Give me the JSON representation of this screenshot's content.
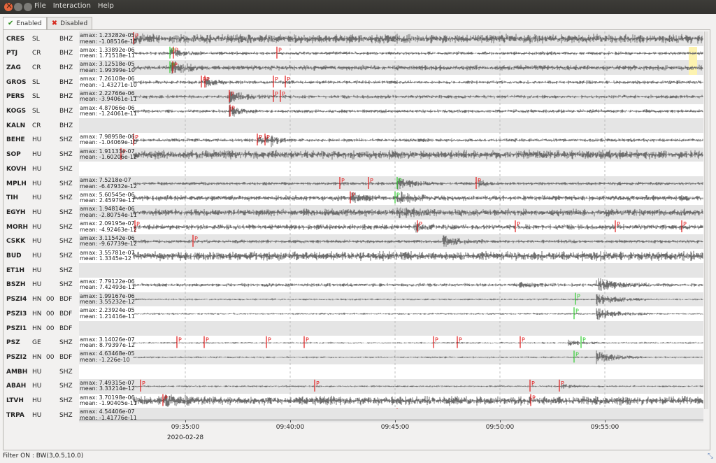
{
  "window": {
    "menu": [
      "File",
      "Interaction",
      "Help"
    ]
  },
  "tabs": [
    {
      "label": "Enabled",
      "icon": "check-icon",
      "active": true
    },
    {
      "label": "Disabled",
      "icon": "x-icon",
      "active": false
    }
  ],
  "colors": {
    "trace": "#6e6e6e",
    "pick_p": "#e01818",
    "pick_auto": "#2ecc2e",
    "highlight": "#fdf3b0",
    "band": "#e5e5e5"
  },
  "stations": [
    {
      "station": "CRES",
      "network": "SL",
      "location": "",
      "channel": "BHZ",
      "amax": "amax: 1.23282e-05",
      "mean": "mean: -1.08516e-10"
    },
    {
      "station": "PTJ",
      "network": "CR",
      "location": "",
      "channel": "BHZ",
      "amax": "amax: 1.33892e-06",
      "mean": "mean: 1.71518e-11"
    },
    {
      "station": "ZAG",
      "network": "CR",
      "location": "",
      "channel": "BHZ",
      "amax": "amax: 3.12518e-05",
      "mean": "mean: 1.99399e-10"
    },
    {
      "station": "GROS",
      "network": "SL",
      "location": "",
      "channel": "BHZ",
      "amax": "amax: 7.26108e-06",
      "mean": "mean: -1.43271e-10"
    },
    {
      "station": "PERS",
      "network": "SL",
      "location": "",
      "channel": "BHZ",
      "amax": "amax: 2.22766e-06",
      "mean": "mean: -3.94061e-11"
    },
    {
      "station": "KOGS",
      "network": "SL",
      "location": "",
      "channel": "BHZ",
      "amax": "amax: 4.87066e-06",
      "mean": "mean: -1.24061e-11"
    },
    {
      "station": "KALN",
      "network": "CR",
      "location": "",
      "channel": "BHZ",
      "amax": "",
      "mean": ""
    },
    {
      "station": "BEHE",
      "network": "HU",
      "location": "",
      "channel": "SHZ",
      "amax": "amax: 7.98958e-06",
      "mean": "mean: -1.04069e-10"
    },
    {
      "station": "SOP",
      "network": "HU",
      "location": "",
      "channel": "SHZ",
      "amax": "amax: 1.91133e-07",
      "mean": "mean: -1.60206e-12"
    },
    {
      "station": "KOVH",
      "network": "HU",
      "location": "",
      "channel": "SHZ",
      "amax": "",
      "mean": ""
    },
    {
      "station": "MPLH",
      "network": "HU",
      "location": "",
      "channel": "SHZ",
      "amax": "amax: 7.5218e-07",
      "mean": "mean: -6.47932e-12"
    },
    {
      "station": "TIH",
      "network": "HU",
      "location": "",
      "channel": "SHZ",
      "amax": "amax: 5.60545e-06",
      "mean": "mean: 2.45979e-11"
    },
    {
      "station": "EGYH",
      "network": "HU",
      "location": "",
      "channel": "SHZ",
      "amax": "amax: 1.94814e-06",
      "mean": "mean: -2.80754e-11"
    },
    {
      "station": "MORH",
      "network": "HU",
      "location": "",
      "channel": "SHZ",
      "amax": "amax: 2.09195e-07",
      "mean": "mean: -4.92463e-12"
    },
    {
      "station": "CSKK",
      "network": "HU",
      "location": "",
      "channel": "SHZ",
      "amax": "amax: 3.11542e-06",
      "mean": "mean: -9.67739e-12"
    },
    {
      "station": "BUD",
      "network": "HU",
      "location": "",
      "channel": "SHZ",
      "amax": "amax: 3.55781e-07",
      "mean": "mean: 1.3345e-12"
    },
    {
      "station": "ET1H",
      "network": "HU",
      "location": "",
      "channel": "SHZ",
      "amax": "",
      "mean": ""
    },
    {
      "station": "BSZH",
      "network": "HU",
      "location": "",
      "channel": "SHZ",
      "amax": "amax: 7.79122e-06",
      "mean": "mean: 7.42493e-11"
    },
    {
      "station": "PSZI4",
      "network": "HN",
      "location": "00",
      "channel": "BDF",
      "amax": "amax: 1.99167e-06",
      "mean": "mean: 3.55232e-12"
    },
    {
      "station": "PSZI3",
      "network": "HN",
      "location": "00",
      "channel": "BDF",
      "amax": "amax: 2.23924e-05",
      "mean": "mean: 1.21416e-11"
    },
    {
      "station": "PSZI1",
      "network": "HN",
      "location": "00",
      "channel": "BDF",
      "amax": "",
      "mean": ""
    },
    {
      "station": "PSZ",
      "network": "GE",
      "location": "",
      "channel": "SHZ",
      "amax": "amax: 3.14026e-07",
      "mean": "mean: 8.79397e-12"
    },
    {
      "station": "PSZI2",
      "network": "HN",
      "location": "00",
      "channel": "BDF",
      "amax": "amax: 4.63468e-05",
      "mean": "mean: -1.226e-10"
    },
    {
      "station": "AMBH",
      "network": "HU",
      "location": "",
      "channel": "SHZ",
      "amax": "",
      "mean": ""
    },
    {
      "station": "ABAH",
      "network": "HU",
      "location": "",
      "channel": "SHZ",
      "amax": "amax: 7.49315e-07",
      "mean": "mean: 3.33214e-12"
    },
    {
      "station": "LTVH",
      "network": "HU",
      "location": "",
      "channel": "SHZ",
      "amax": "amax: 3.70198e-06",
      "mean": "mean: -1.90405e-11"
    },
    {
      "station": "TRPA",
      "network": "HU",
      "location": "",
      "channel": "SHZ",
      "amax": "amax: 4.54406e-07",
      "mean": "mean: -1.41776e-11"
    }
  ],
  "time_axis": {
    "ticks": [
      "09:35:00",
      "09:40:00",
      "09:45:00",
      "09:50:00",
      "09:55:00"
    ],
    "date": "2020-02-28"
  },
  "pick_label": "P",
  "status": {
    "filter": "Filter ON : BW(3,0.5,10.0)"
  }
}
